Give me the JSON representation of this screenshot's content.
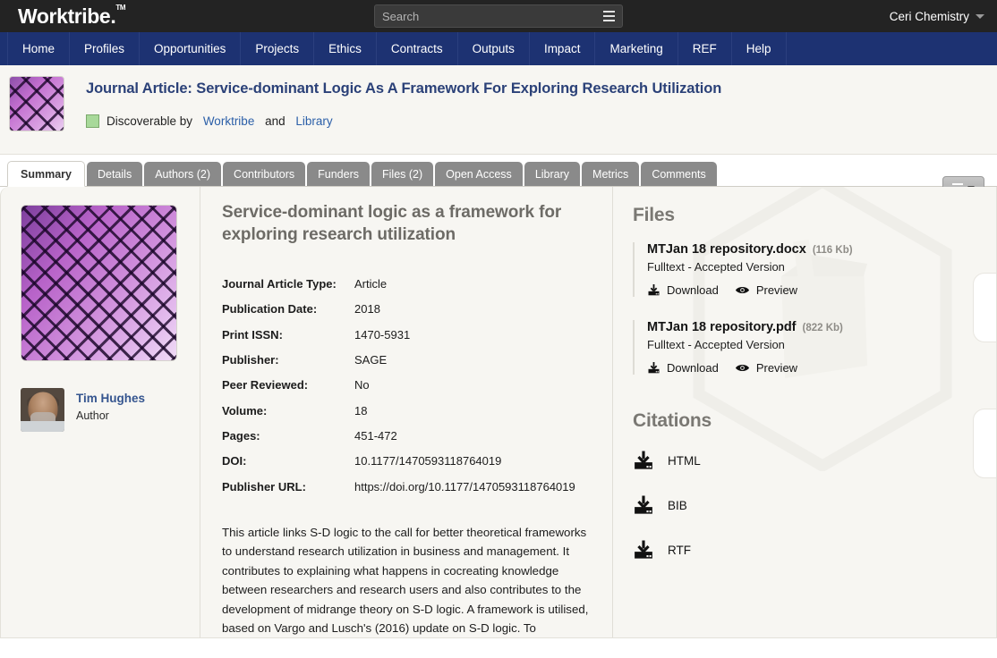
{
  "topbar": {
    "brand": "Worktribe.",
    "brand_tm": "TM",
    "search_placeholder": "Search",
    "search_value": "",
    "search_menu_icon": "hamburger-icon",
    "user": "Ceri Chemistry"
  },
  "nav": {
    "items": [
      {
        "label": "Home"
      },
      {
        "label": "Profiles"
      },
      {
        "label": "Opportunities"
      },
      {
        "label": "Projects"
      },
      {
        "label": "Ethics"
      },
      {
        "label": "Contracts"
      },
      {
        "label": "Outputs"
      },
      {
        "label": "Impact"
      },
      {
        "label": "Marketing"
      },
      {
        "label": "REF"
      },
      {
        "label": "Help"
      }
    ]
  },
  "record_header": {
    "title": "Journal Article: Service-dominant Logic As A Framework For Exploring Research Utilization",
    "discoverable_prefix": "Discoverable by",
    "discoverable_link_1": "Worktribe",
    "discoverable_and": "and",
    "discoverable_link_2": "Library",
    "status_color": "#a8d99a",
    "menu_button_icon": "hamburger-icon"
  },
  "tabs": [
    {
      "label": "Summary",
      "active": true
    },
    {
      "label": "Details",
      "active": false
    },
    {
      "label": "Authors (2)",
      "active": false
    },
    {
      "label": "Contributors",
      "active": false
    },
    {
      "label": "Funders",
      "active": false
    },
    {
      "label": "Files (2)",
      "active": false
    },
    {
      "label": "Open Access",
      "active": false
    },
    {
      "label": "Library",
      "active": false
    },
    {
      "label": "Metrics",
      "active": false
    },
    {
      "label": "Comments",
      "active": false
    }
  ],
  "left_column": {
    "cover_image_alt": "purple-lattice-cover",
    "author": {
      "name": "Tim Hughes",
      "role": "Author"
    }
  },
  "main": {
    "title": "Service-dominant logic as a framework for exploring research utilization",
    "fields": [
      {
        "key": "Journal Article Type:",
        "value": "Article"
      },
      {
        "key": "Publication Date:",
        "value": "2018"
      },
      {
        "key": "Print ISSN:",
        "value": "1470-5931"
      },
      {
        "key": "Publisher:",
        "value": "SAGE"
      },
      {
        "key": "Peer Reviewed:",
        "value": "No"
      },
      {
        "key": "Volume:",
        "value": "18"
      },
      {
        "key": "Pages:",
        "value": "451-472"
      },
      {
        "key": "DOI:",
        "value": "10.1177/1470593118764019"
      },
      {
        "key": "Publisher URL:",
        "value": "https://doi.org/10.1177/1470593118764019"
      }
    ],
    "abstract": "This article links S-D logic to the call for better theoretical frameworks to understand research utilization in business and management. It contributes to explaining what happens in cocreating knowledge between researchers and research users and also contributes to the development of midrange theory on S-D logic. A framework is utilised, based on Vargo and Lusch's (2016) update on S-D logic. To demonstrate application, the framework is applied to an example of"
  },
  "files_panel": {
    "title": "Files",
    "items": [
      {
        "name": "MTJan 18 repository.docx",
        "size": "(116 Kb)",
        "description": "Fulltext - Accepted Version",
        "download_label": "Download",
        "preview_label": "Preview"
      },
      {
        "name": "MTJan 18 repository.pdf",
        "size": "(822 Kb)",
        "description": "Fulltext - Accepted Version",
        "download_label": "Download",
        "preview_label": "Preview"
      }
    ]
  },
  "citations_panel": {
    "title": "Citations",
    "items": [
      {
        "label": "HTML"
      },
      {
        "label": "BIB"
      },
      {
        "label": "RTF"
      }
    ]
  }
}
